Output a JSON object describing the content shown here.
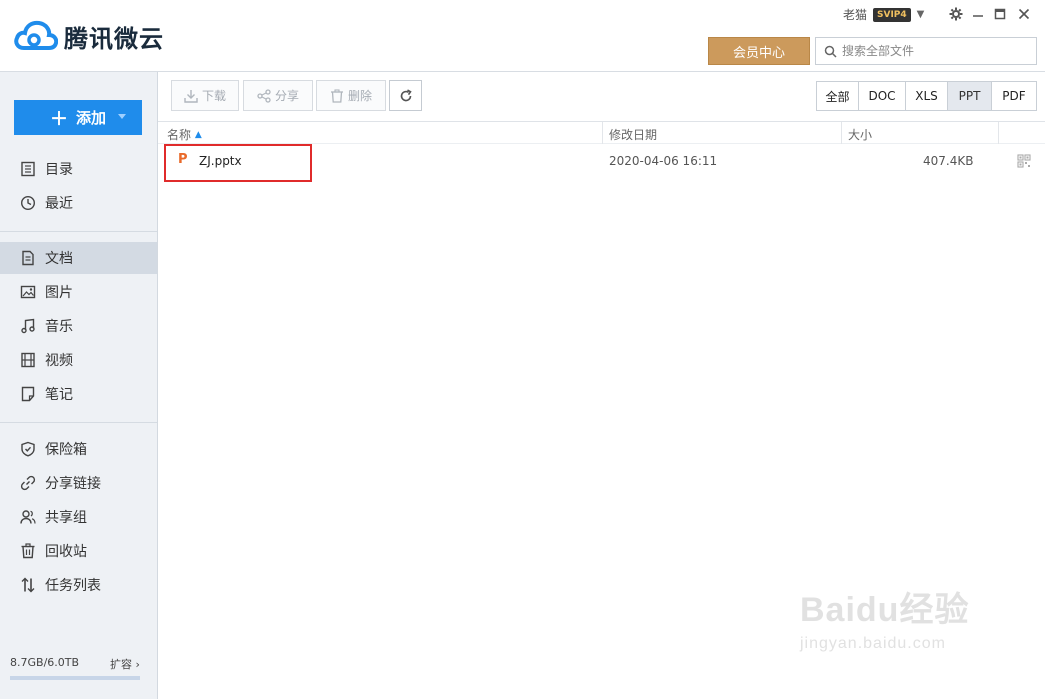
{
  "app": {
    "name": "腾讯微云"
  },
  "user": {
    "name": "老猫",
    "vip": "SVIP4"
  },
  "header": {
    "member_center": "会员中心",
    "search_placeholder": "搜索全部文件"
  },
  "sidebar": {
    "add_label": "添加",
    "groups": [
      [
        {
          "label": "目录",
          "icon": "directory-icon"
        },
        {
          "label": "最近",
          "icon": "clock-icon"
        }
      ],
      [
        {
          "label": "文档",
          "icon": "document-icon",
          "active": true
        },
        {
          "label": "图片",
          "icon": "image-icon"
        },
        {
          "label": "音乐",
          "icon": "music-icon"
        },
        {
          "label": "视频",
          "icon": "video-icon"
        },
        {
          "label": "笔记",
          "icon": "note-icon"
        }
      ],
      [
        {
          "label": "保险箱",
          "icon": "shield-icon"
        },
        {
          "label": "分享链接",
          "icon": "link-icon"
        },
        {
          "label": "共享组",
          "icon": "group-icon"
        },
        {
          "label": "回收站",
          "icon": "trash-icon"
        },
        {
          "label": "任务列表",
          "icon": "task-list-icon"
        }
      ]
    ],
    "storage": "8.7GB/6.0TB",
    "expand": "扩容"
  },
  "toolbar": {
    "download": "下载",
    "share": "分享",
    "delete": "删除"
  },
  "filters": [
    {
      "label": "全部",
      "active": false
    },
    {
      "label": "DOC",
      "active": false
    },
    {
      "label": "XLS",
      "active": false
    },
    {
      "label": "PPT",
      "active": true
    },
    {
      "label": "PDF",
      "active": false
    }
  ],
  "table": {
    "columns": {
      "name": "名称",
      "modified": "修改日期",
      "size": "大小"
    },
    "rows": [
      {
        "name": "ZJ.pptx",
        "modified": "2020-04-06 16:11",
        "size": "407.4KB"
      }
    ]
  },
  "watermark": {
    "brand": "Baidu经验",
    "url": "jingyan.baidu.com"
  },
  "colors": {
    "accent": "#1f8ceb",
    "member": "#cc9a5c",
    "ppt_icon": "#e96a2a",
    "highlight": "#e02b2b"
  }
}
